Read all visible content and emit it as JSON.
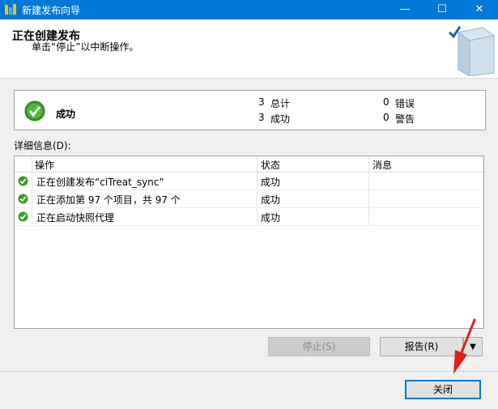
{
  "window": {
    "title": "新建发布向导",
    "minimize_glyph": "—",
    "maximize_glyph": "☐",
    "close_glyph": "✕"
  },
  "header": {
    "title": "正在创建发布",
    "subtitle": "单击“停止”以中断操作。"
  },
  "summary": {
    "status": "成功",
    "total_count": "3",
    "total_label": "总计",
    "success_count": "3",
    "success_label": "成功",
    "error_count": "0",
    "error_label": "错误",
    "warning_count": "0",
    "warning_label": "警告"
  },
  "details": {
    "label": "详细信息(D):",
    "columns": [
      "操作",
      "状态",
      "消息"
    ],
    "rows": [
      {
        "action": "正在创建发布“ciTreat_sync”",
        "status": "成功",
        "message": ""
      },
      {
        "action": "正在添加第 97 个项目，共 97 个",
        "status": "成功",
        "message": ""
      },
      {
        "action": "正在启动快照代理",
        "status": "成功",
        "message": ""
      }
    ]
  },
  "buttons": {
    "stop": "停止(S)",
    "report": "报告(R)",
    "report_dropdown": "▼",
    "close": "关闭"
  },
  "colors": {
    "titlebar": "#0078d7",
    "success": "#3a9a2e",
    "annotation_arrow": "#e02020"
  },
  "icons": [
    "app-icon",
    "success-check-icon",
    "wizard-book-icon",
    "annotation-arrow"
  ]
}
